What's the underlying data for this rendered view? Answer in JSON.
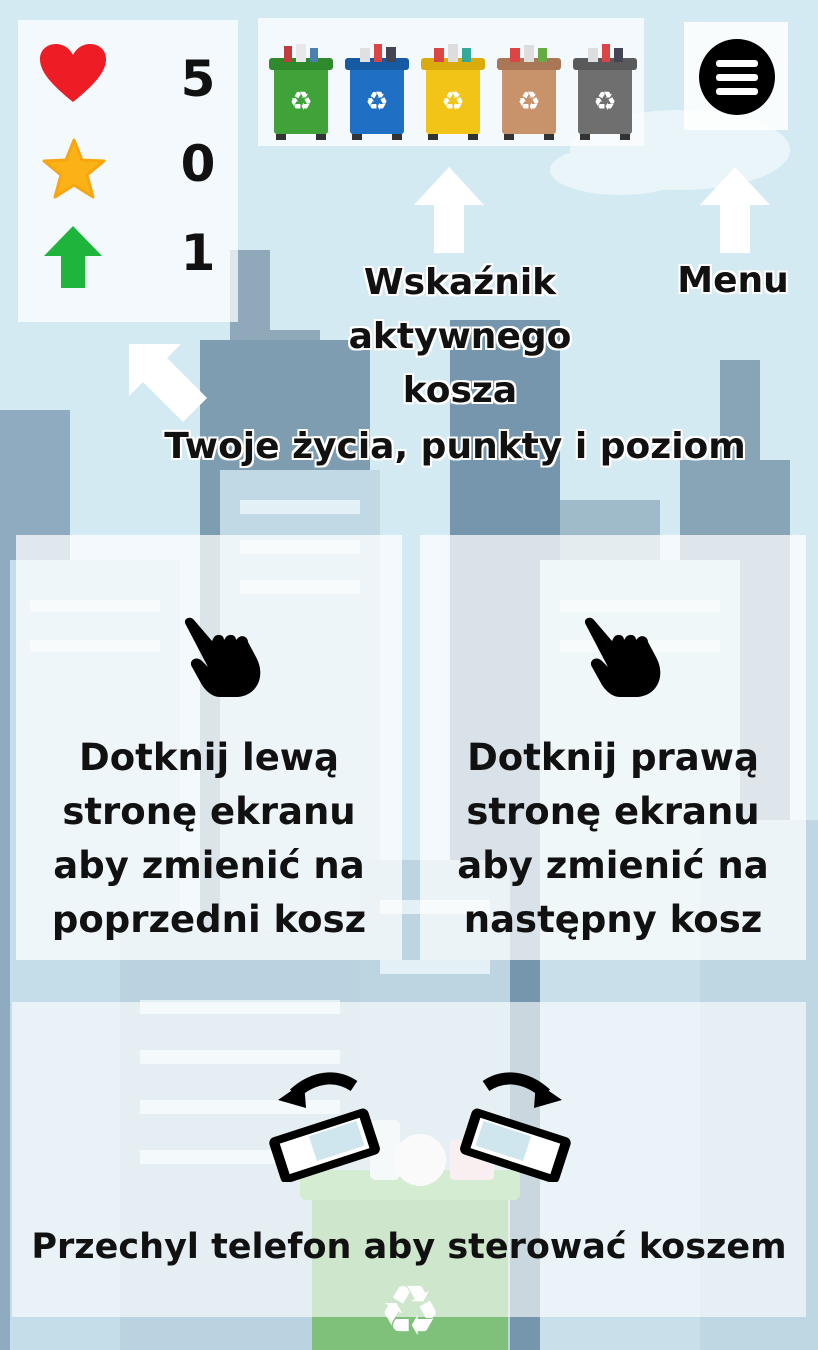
{
  "stats": {
    "lives": "5",
    "points": "0",
    "level": "1"
  },
  "bins": [
    {
      "name": "green-bin",
      "color": "#3fa33a"
    },
    {
      "name": "blue-bin",
      "color": "#1f6fc4"
    },
    {
      "name": "yellow-bin",
      "color": "#f2c417"
    },
    {
      "name": "brown-bin",
      "color": "#c8926a"
    },
    {
      "name": "gray-bin",
      "color": "#6f6f6f"
    }
  ],
  "labels": {
    "active_bin_line1": "Wskaźnik aktywnego",
    "active_bin_line2": "kosza",
    "menu": "Menu",
    "stats_caption": "Twoje życia, punkty i poziom"
  },
  "hints": {
    "left_line1": "Dotknij lewą",
    "left_line2": "stronę ekranu",
    "left_line3": "aby zmienić na",
    "left_line4": "poprzedni kosz",
    "right_line1": "Dotknij prawą",
    "right_line2": "stronę ekranu",
    "right_line3": "aby zmienić na",
    "right_line4": "następny kosz",
    "tilt": "Przechyl telefon aby sterować koszem"
  },
  "icons": {
    "lives": "heart-icon",
    "points": "star-icon",
    "level": "up-arrow-icon",
    "menu": "hamburger-icon",
    "tap": "tap-hand-icon",
    "tilt": "tilt-phone-icon"
  },
  "colors": {
    "heart": "#ee1c25",
    "star": "#fbb216",
    "arrow": "#1fb53d",
    "sky": "#cfe6ef",
    "building": "#7f9db1"
  }
}
